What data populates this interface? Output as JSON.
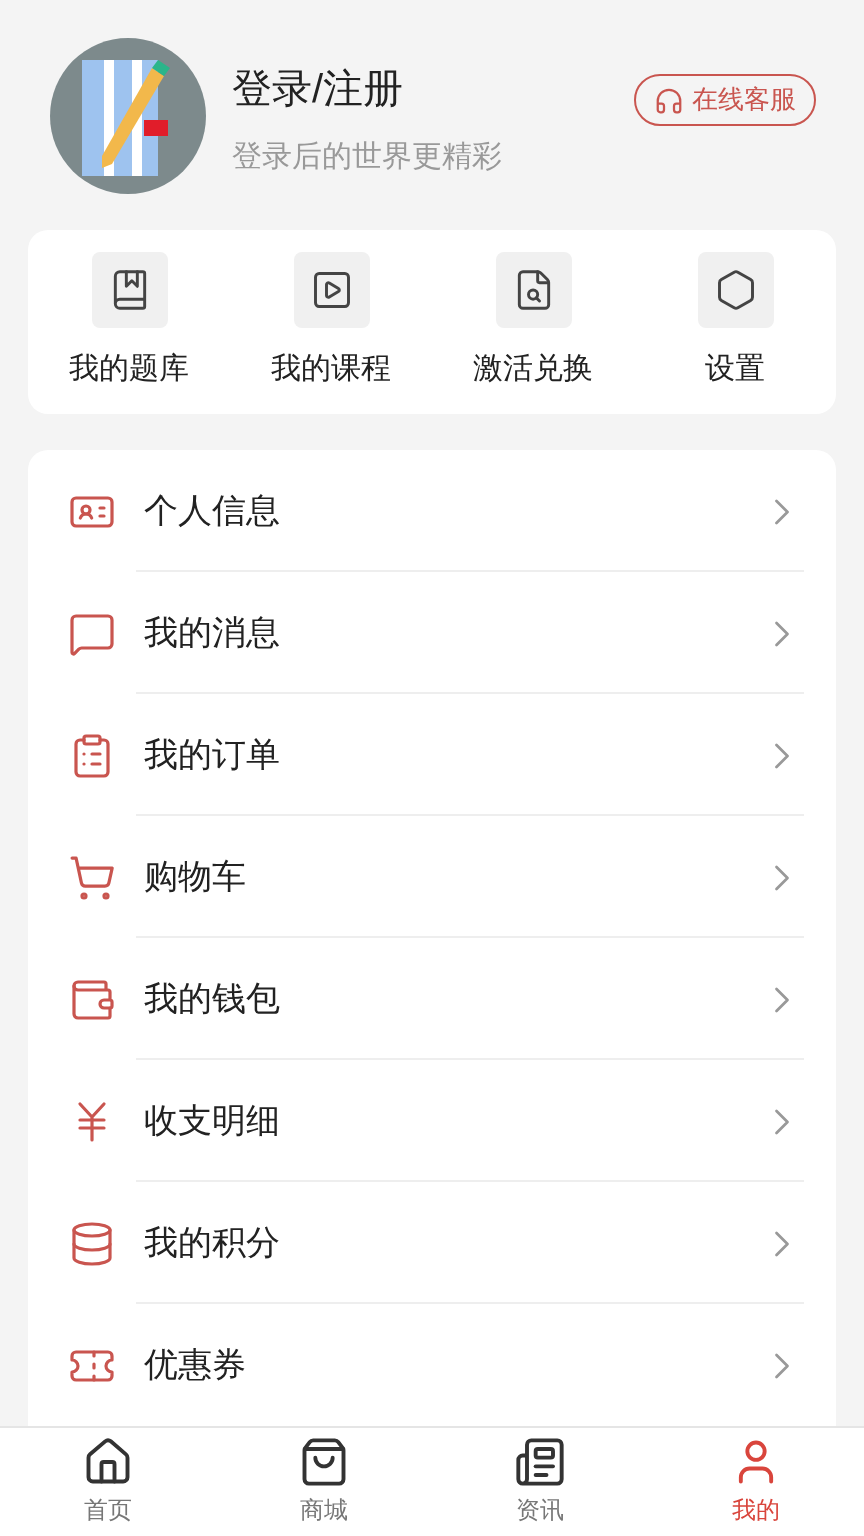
{
  "profile": {
    "title": "登录/注册",
    "subtitle": "登录后的世界更精彩",
    "service_button": "在线客服"
  },
  "shortcuts": [
    {
      "label": "我的题库",
      "kind": "bank"
    },
    {
      "label": "我的课程",
      "kind": "course"
    },
    {
      "label": "激活兑换",
      "kind": "activate"
    },
    {
      "label": "设置",
      "kind": "settings"
    }
  ],
  "menu": [
    {
      "label": "个人信息",
      "kind": "profile"
    },
    {
      "label": "我的消息",
      "kind": "message"
    },
    {
      "label": "我的订单",
      "kind": "order"
    },
    {
      "label": "购物车",
      "kind": "cart"
    },
    {
      "label": "我的钱包",
      "kind": "wallet"
    },
    {
      "label": "收支明细",
      "kind": "finance"
    },
    {
      "label": "我的积分",
      "kind": "points"
    },
    {
      "label": "优惠券",
      "kind": "coupon"
    }
  ],
  "tab_bar": [
    {
      "label": "首页",
      "kind": "home",
      "selected": false
    },
    {
      "label": "商城",
      "kind": "shop",
      "selected": false
    },
    {
      "label": "资讯",
      "kind": "news",
      "selected": false
    },
    {
      "label": "我的",
      "kind": "me",
      "selected": true
    }
  ]
}
